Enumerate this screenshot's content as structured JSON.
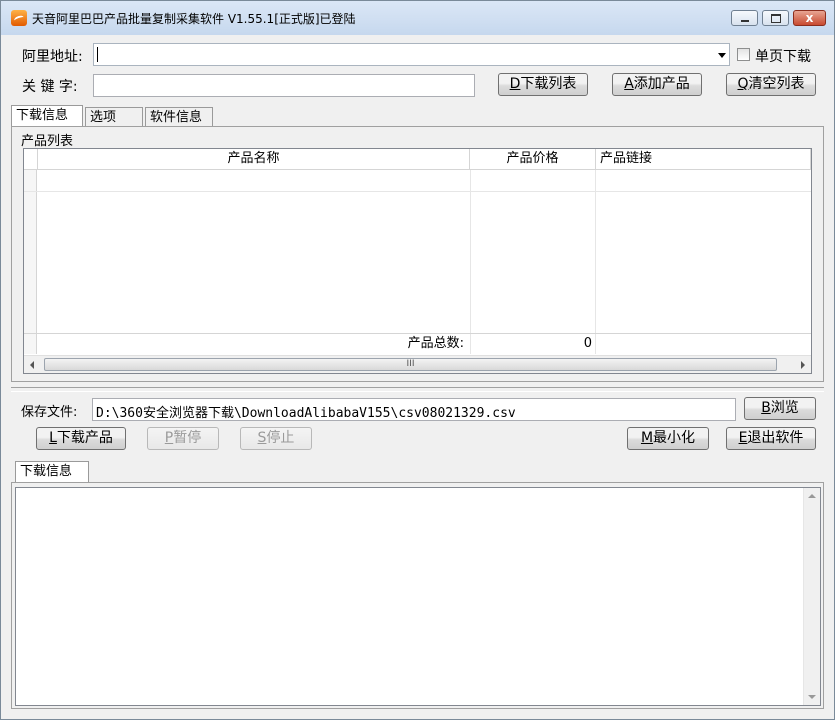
{
  "window": {
    "title": "天音阿里巴巴产品批量复制采集软件 V1.55.1[正式版]已登陆",
    "close_glyph": "x"
  },
  "top_form": {
    "url_label": "阿里地址:",
    "url_value": "",
    "single_page_label": "单页下载",
    "keyword_label": "关 键 字:",
    "keyword_value": "",
    "btn_download_list": "D下载列表",
    "btn_add_product": "A添加产品",
    "btn_clear_list": "Q清空列表"
  },
  "tabs": [
    "下载信息",
    "选项",
    "软件信息"
  ],
  "product_list": {
    "group_label": "产品列表",
    "columns": [
      "产品名称",
      "产品价格",
      "产品链接"
    ],
    "rows": [],
    "total_label": "产品总数:",
    "total_value": "0",
    "scroll_grip": "III"
  },
  "save": {
    "label": "保存文件:",
    "path": "D:\\360安全浏览器下载\\DownloadAlibabaV155\\csv08021329.csv",
    "btn_browse": "B浏览"
  },
  "actions": {
    "download": "L下载产品",
    "pause": "P暂停",
    "stop": "S停止",
    "minimize": "M最小化",
    "exit": "E退出软件"
  },
  "log": {
    "tab_label": "下载信息",
    "content": ""
  }
}
